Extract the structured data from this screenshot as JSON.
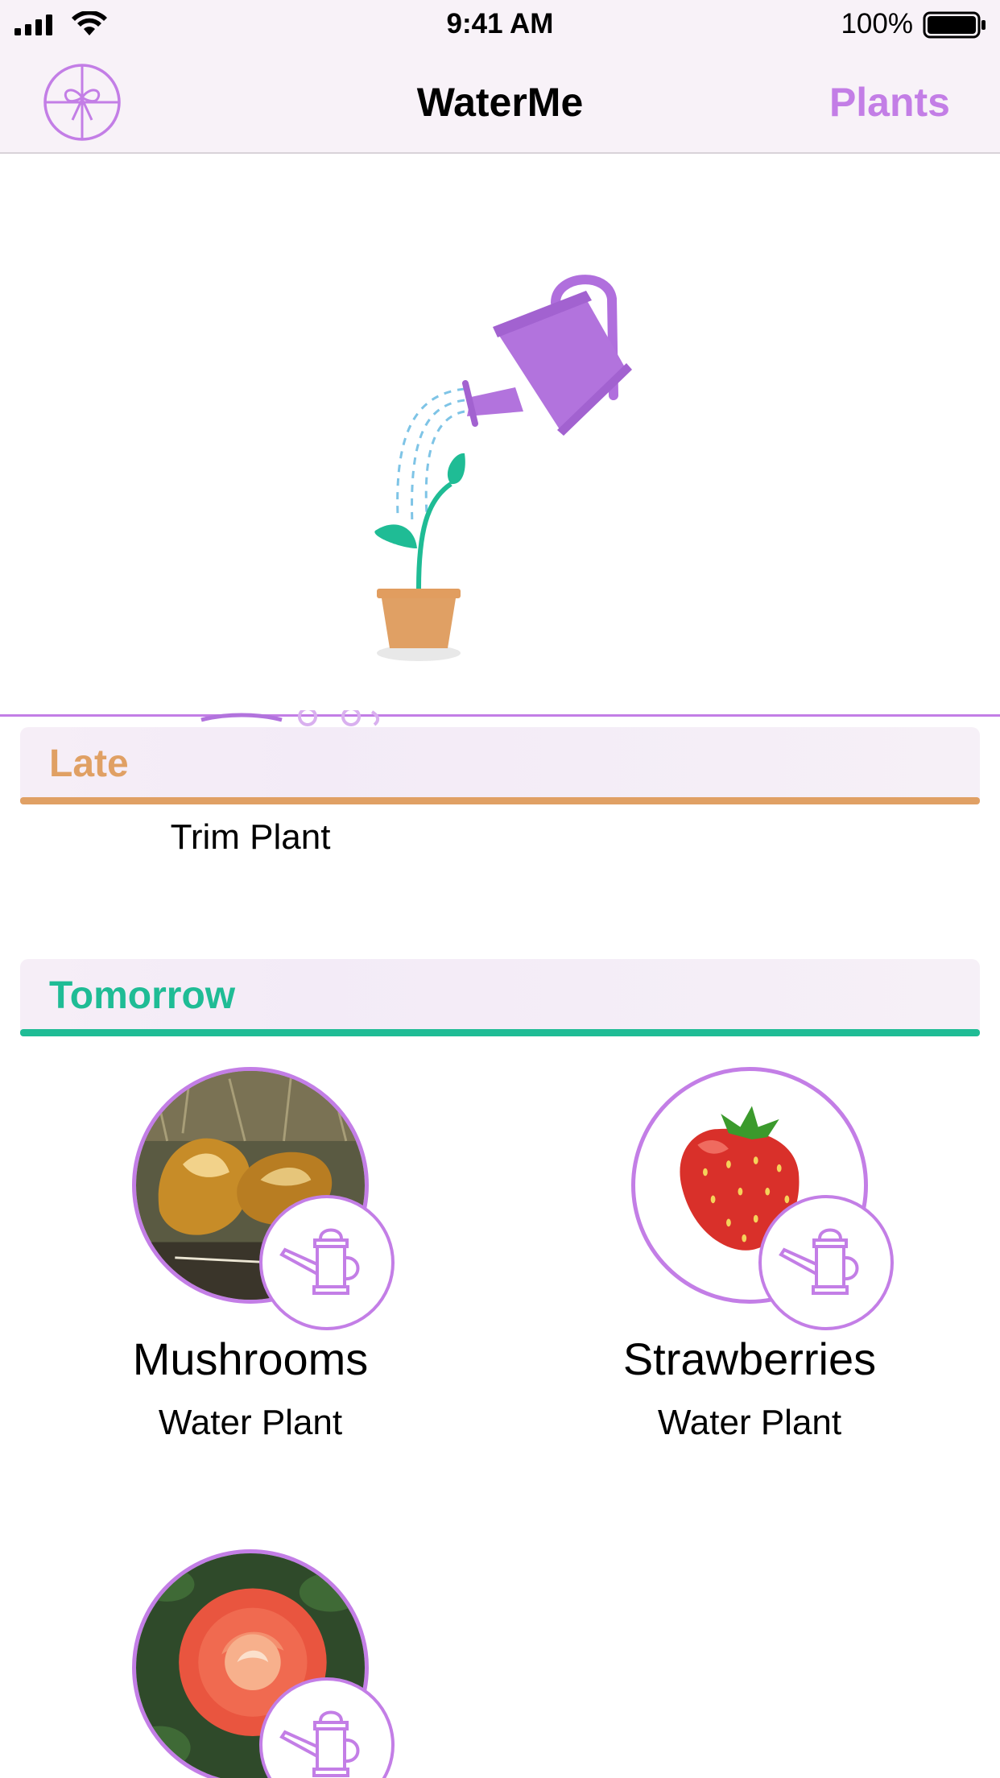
{
  "status_bar": {
    "time": "9:41 AM",
    "battery_text": "100%",
    "icons": [
      "cellular-signal-icon",
      "wifi-icon",
      "battery-icon"
    ]
  },
  "nav": {
    "title": "WaterMe",
    "right_button": "Plants",
    "left_icon": "gift-icon",
    "accent_color": "#c37ee6"
  },
  "hero": {
    "illustration": "watering-can-plant-illustration"
  },
  "sections": [
    {
      "title": "Late",
      "color": "#e0a064",
      "items": [
        {
          "name": "",
          "subtitle": "Trim Plant"
        }
      ]
    },
    {
      "title": "Tomorrow",
      "color": "#1fbc95",
      "items": [
        {
          "name": "Mushrooms",
          "subtitle": "Water Plant",
          "image": "mushroom-photo"
        },
        {
          "name": "Strawberries",
          "subtitle": "Water Plant",
          "image": "strawberry-emoji"
        },
        {
          "name": "",
          "subtitle": "",
          "image": "rose-photo"
        }
      ]
    }
  ]
}
